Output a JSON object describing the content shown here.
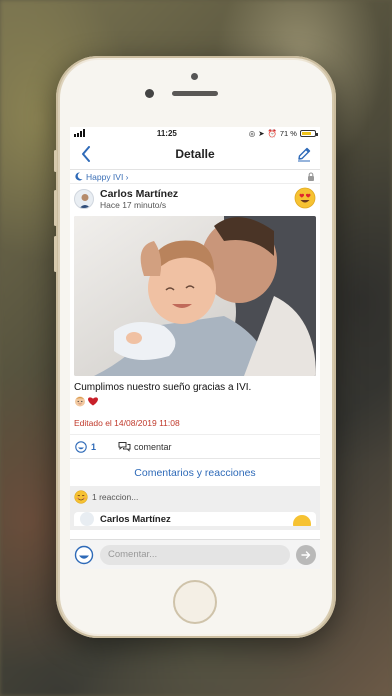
{
  "status_bar": {
    "time": "11:25",
    "battery": "71 %",
    "battery_level": 0.71
  },
  "nav": {
    "title": "Detalle",
    "back_icon": "chevron-left-icon",
    "edit_icon": "pencil-icon"
  },
  "group": {
    "name": "Happy IVI ›",
    "icon": "moon-icon",
    "lock_icon": "lock-icon"
  },
  "post": {
    "author": "Carlos Martínez",
    "time": "Hace 17 minuto/s",
    "reaction_icon": "heart-eyes-emoji",
    "caption": "Cumplimos nuestro sueño gracias a IVI.",
    "inline_emojis": [
      "baby-emoji",
      "heart-emoji"
    ],
    "edited": "Editado el 14/08/2019 11:08",
    "reaction_count": "1",
    "comment_label": "comentar"
  },
  "comments": {
    "title": "Comentarios y reacciones",
    "summary": "1 reaccion...",
    "first_author": "Carlos Martínez"
  },
  "composer": {
    "placeholder": "Comentar..."
  },
  "colors": {
    "accent": "#2e6ab8",
    "edited": "#c0392b",
    "battery": "#f0c419"
  }
}
